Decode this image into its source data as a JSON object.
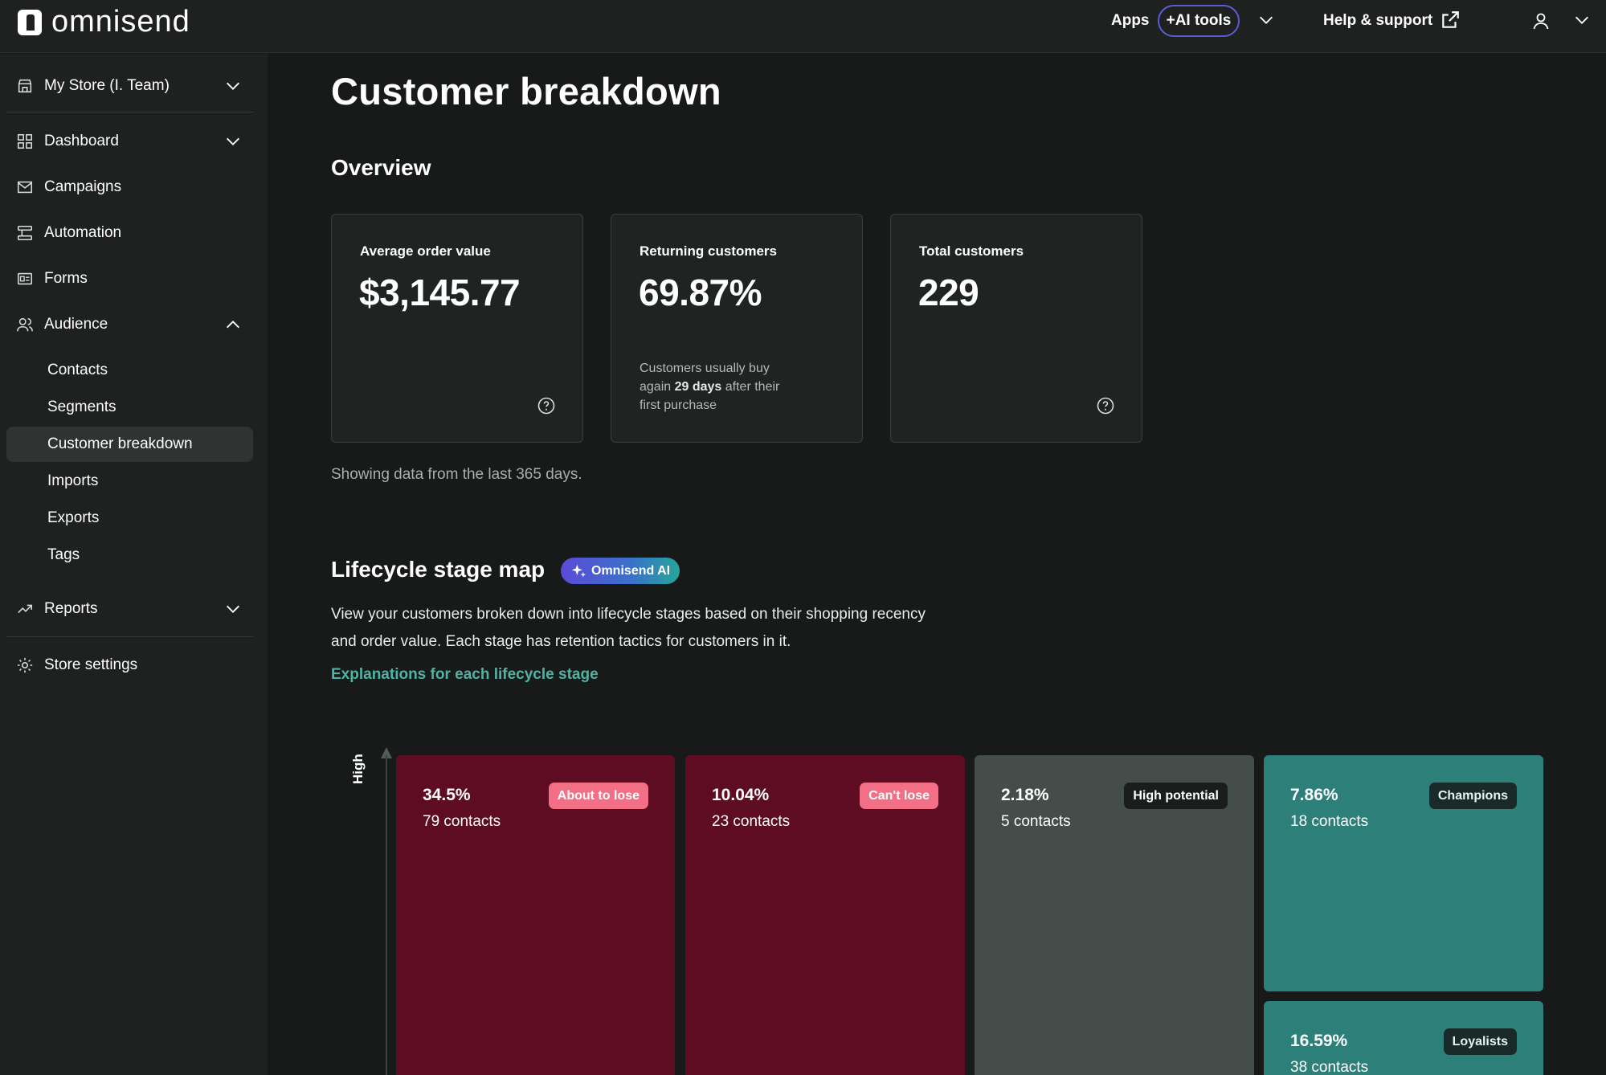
{
  "app": {
    "logo_text": "omnisend"
  },
  "topbar": {
    "apps_label": "Apps",
    "ai_tools_label": "+AI tools",
    "help_label": "Help & support"
  },
  "sidebar": {
    "store": "My Store (I. Team)",
    "items": [
      {
        "label": "Dashboard"
      },
      {
        "label": "Campaigns"
      },
      {
        "label": "Automation"
      },
      {
        "label": "Forms"
      },
      {
        "label": "Audience"
      }
    ],
    "audience_sub": [
      {
        "label": "Contacts"
      },
      {
        "label": "Segments"
      },
      {
        "label": "Customer breakdown"
      },
      {
        "label": "Imports"
      },
      {
        "label": "Exports"
      },
      {
        "label": "Tags"
      }
    ],
    "reports": "Reports",
    "store_settings": "Store settings"
  },
  "main": {
    "title": "Customer breakdown",
    "overview_title": "Overview",
    "cards": [
      {
        "title": "Average order value",
        "value": "$3,145.77"
      },
      {
        "title": "Returning customers",
        "value": "69.87%",
        "note_pre": "Customers usually buy again ",
        "note_bold": "29 days",
        "note_post": " after their first purchase"
      },
      {
        "title": "Total customers",
        "value": "229"
      }
    ],
    "data_note": "Showing data from the last 365 days.",
    "lifecycle_title": "Lifecycle stage map",
    "ai_badge": "Omnisend AI",
    "lifecycle_desc": "View your customers broken down into lifecycle stages based on their shopping recency and order value. Each stage has retention tactics for customers in it.",
    "lifecycle_link": "Explanations for each lifecycle stage",
    "axis_label": "High"
  },
  "stages": [
    {
      "pct": "34.5%",
      "contacts": "79 contacts",
      "tag": "About to lose",
      "color": "#5e0c21"
    },
    {
      "pct": "10.04%",
      "contacts": "23 contacts",
      "tag": "Can't lose",
      "color": "#5e0c21"
    },
    {
      "pct": "2.18%",
      "contacts": "5 contacts",
      "tag": "High potential",
      "color": "#454d4b"
    },
    {
      "pct": "7.86%",
      "contacts": "18 contacts",
      "tag": "Champions",
      "color": "#2d807a"
    },
    {
      "pct": "16.59%",
      "contacts": "38 contacts",
      "tag": "Loyalists",
      "color": "#2d807a"
    }
  ]
}
